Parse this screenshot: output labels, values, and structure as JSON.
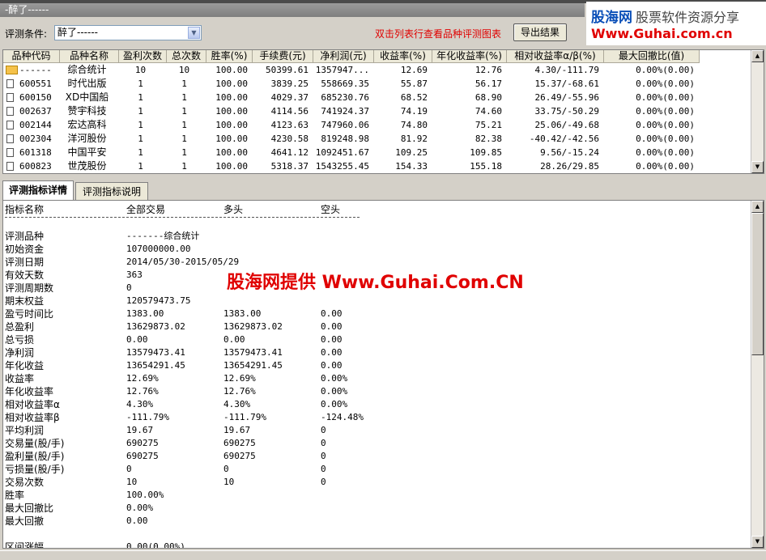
{
  "window": {
    "title": "-醉了------"
  },
  "logo": {
    "brand": "股海网",
    "tag": "股票软件资源分享",
    "url": "Www.Guhai.com.cn"
  },
  "toolbar": {
    "condition_label": "评测条件:",
    "condition_value": "醉了------",
    "hint": "双击列表行查看品种评测图表",
    "export_label": "导出结果"
  },
  "table": {
    "columns": [
      "品种代码",
      "品种名称",
      "盈利次数",
      "总次数",
      "胜率(%)",
      "手续费(元)",
      "净利润(元)",
      "收益率(%)",
      "年化收益率(%)",
      "相对收益率α/β(%)",
      "最大回撤比(值)"
    ],
    "rows": [
      [
        "------",
        "综合统计",
        "10",
        "10",
        "100.00",
        "50399.61",
        "1357947...",
        "12.69",
        "12.76",
        "4.30/-111.79",
        "0.00%(0.00)"
      ],
      [
        "600551",
        "时代出版",
        "1",
        "1",
        "100.00",
        "3839.25",
        "558669.35",
        "55.87",
        "56.17",
        "15.37/-68.61",
        "0.00%(0.00)"
      ],
      [
        "600150",
        "XD中国船",
        "1",
        "1",
        "100.00",
        "4029.37",
        "685230.76",
        "68.52",
        "68.90",
        "26.49/-55.96",
        "0.00%(0.00)"
      ],
      [
        "002637",
        "赞宇科技",
        "1",
        "1",
        "100.00",
        "4114.56",
        "741924.37",
        "74.19",
        "74.60",
        "33.75/-50.29",
        "0.00%(0.00)"
      ],
      [
        "002144",
        "宏达高科",
        "1",
        "1",
        "100.00",
        "4123.63",
        "747960.06",
        "74.80",
        "75.21",
        "25.06/-49.68",
        "0.00%(0.00)"
      ],
      [
        "002304",
        "洋河股份",
        "1",
        "1",
        "100.00",
        "4230.58",
        "819248.98",
        "81.92",
        "82.38",
        "-40.42/-42.56",
        "0.00%(0.00)"
      ],
      [
        "601318",
        "中国平安",
        "1",
        "1",
        "100.00",
        "4641.12",
        "1092451.67",
        "109.25",
        "109.85",
        "9.56/-15.24",
        "0.00%(0.00)"
      ],
      [
        "600823",
        "世茂股份",
        "1",
        "1",
        "100.00",
        "5318.37",
        "1543255.45",
        "154.33",
        "155.18",
        "28.26/29.85",
        "0.00%(0.00)"
      ]
    ]
  },
  "tabs": [
    "评测指标详情",
    "评测指标说明"
  ],
  "detail": {
    "header": [
      "指标名称",
      "全部交易",
      "多头",
      "空头"
    ],
    "lines": [
      [
        "评测品种",
        "-------综合统计",
        "",
        ""
      ],
      [
        "初始资金",
        "107000000.00",
        "",
        ""
      ],
      [
        "评测日期",
        "2014/05/30-2015/05/29",
        "",
        ""
      ],
      [
        "有效天数",
        "363",
        "",
        ""
      ],
      [
        "评测周期数",
        "0",
        "",
        ""
      ],
      [
        "期末权益",
        "120579473.75",
        "",
        ""
      ],
      [
        "盈亏时间比",
        "1383.00",
        "1383.00",
        "0.00"
      ],
      [
        "总盈利",
        "13629873.02",
        "13629873.02",
        "0.00"
      ],
      [
        "总亏损",
        "0.00",
        "0.00",
        "0.00"
      ],
      [
        "净利润",
        "13579473.41",
        "13579473.41",
        "0.00"
      ],
      [
        "年化收益",
        "13654291.45",
        "13654291.45",
        "0.00"
      ],
      [
        "收益率",
        "12.69%",
        "12.69%",
        "0.00%"
      ],
      [
        "年化收益率",
        "12.76%",
        "12.76%",
        "0.00%"
      ],
      [
        "相对收益率α",
        "4.30%",
        "4.30%",
        "0.00%"
      ],
      [
        "相对收益率β",
        "-111.79%",
        "-111.79%",
        "-124.48%"
      ],
      [
        "平均利润",
        "19.67",
        "19.67",
        "0"
      ],
      [
        "交易量(股/手)",
        "690275",
        "690275",
        "0"
      ],
      [
        "盈利量(股/手)",
        "690275",
        "690275",
        "0"
      ],
      [
        "亏损量(股/手)",
        "0",
        "0",
        "0"
      ],
      [
        "交易次数",
        "10",
        "10",
        "0"
      ],
      [
        "胜率",
        "100.00%",
        "",
        ""
      ],
      [
        "最大回撤比",
        "0.00%",
        "",
        ""
      ],
      [
        "最大回撤",
        "0.00",
        "",
        ""
      ],
      [
        "",
        "",
        " ",
        ""
      ],
      [
        "区间涨幅",
        "0.00(0.00%)",
        "",
        ""
      ]
    ]
  },
  "watermark": "股海网提供 Www.Guhai.Com.CN",
  "icons": {
    "combo_arrow": "chevron-down-icon",
    "row_doc": "document-icon",
    "row_folder": "folder-icon"
  }
}
